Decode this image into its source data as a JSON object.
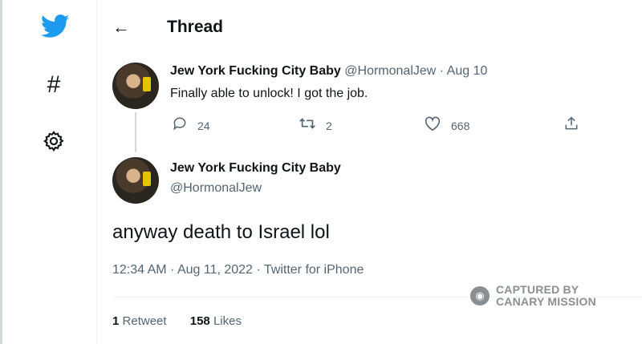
{
  "header": {
    "back_label": "←",
    "title": "Thread"
  },
  "sidebar": {
    "hashtag_glyph": "#"
  },
  "tweet1": {
    "name": "Jew York Fucking City Baby",
    "handle": "@HormonalJew",
    "separator": "·",
    "date": "Aug 10",
    "text": "Finally able to unlock! I got the job.",
    "reply_count": "24",
    "retweet_count": "2",
    "like_count": "668"
  },
  "tweet2": {
    "name": "Jew York Fucking City Baby",
    "handle": "@HormonalJew",
    "text": "anyway death to Israel lol",
    "meta": "12:34 AM · Aug 11, 2022 · Twitter for iPhone",
    "retweets_num": "1",
    "retweets_label": "Retweet",
    "likes_num": "158",
    "likes_label": "Likes"
  },
  "watermark": {
    "line1": "CAPTURED BY",
    "line2": "CANARY MISSION"
  },
  "colors": {
    "brand": "#1d9bf0",
    "secondary_text": "#536471",
    "text": "#0f1419"
  }
}
